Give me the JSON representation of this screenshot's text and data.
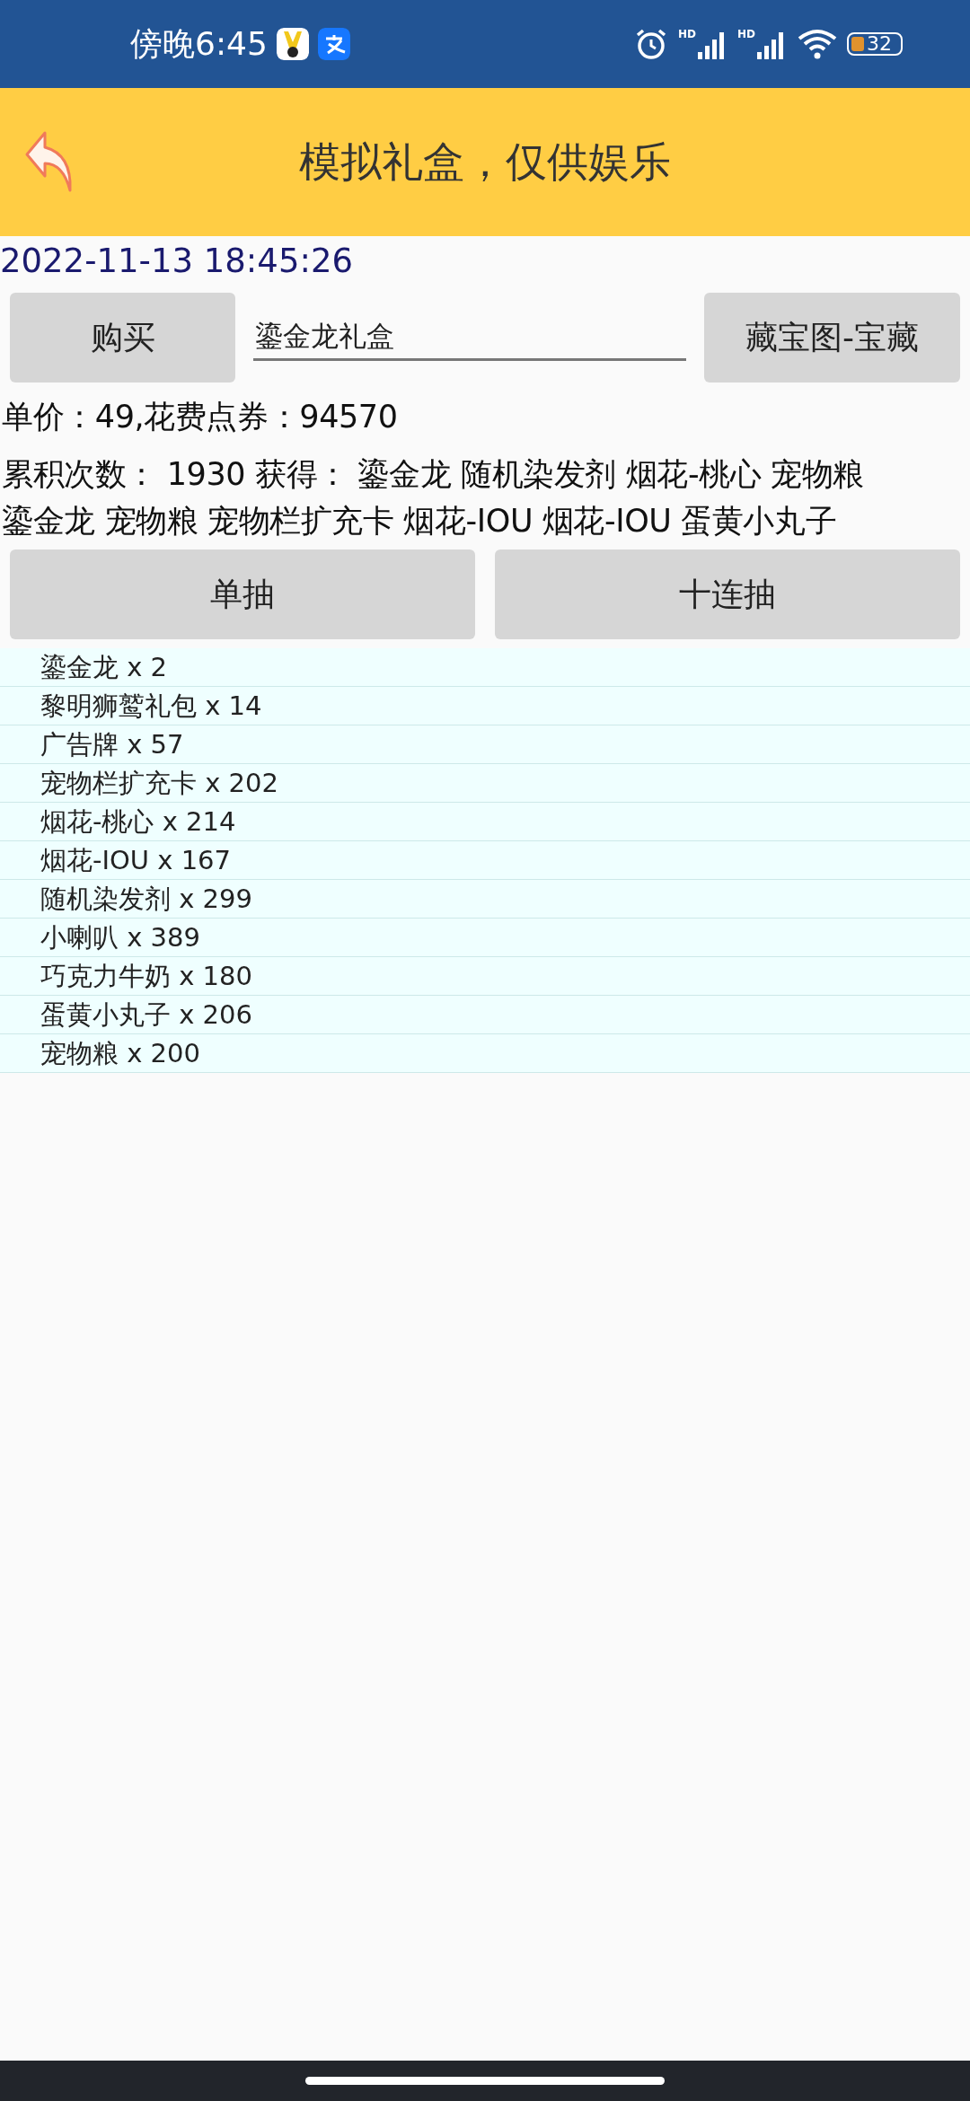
{
  "status_bar": {
    "time": "傍晚6:45",
    "signals": [
      {
        "label": "HD"
      },
      {
        "label": "HD"
      }
    ],
    "battery": "32"
  },
  "header": {
    "title": "模拟礼盒，仅供娱乐"
  },
  "timestamp": "2022-11-13 18:45:26",
  "purchase": {
    "buy_button": "购买",
    "box_field": {
      "value": "鎏金龙礼盒"
    },
    "treasure_button": "藏宝图-宝藏"
  },
  "info_lines": [
    "单价：49,花费点券：94570",
    "累积次数： 1930 获得：  鎏金龙 随机染发剂 烟花-桃心 宠物粮鎏金龙 宠物粮 宠物栏扩充卡 烟花-IOU 烟花-IOU 蛋黄小丸子"
  ],
  "draw_buttons": [
    "单抽",
    "十连抽"
  ],
  "results": [
    "鎏金龙 x 2",
    "黎明狮鹫礼包 x 14",
    "广告牌 x 57",
    "宠物栏扩充卡 x 202",
    "烟花-桃心 x 214",
    "烟花-IOU x 167",
    "随机染发剂 x 299",
    "小喇叭 x 389",
    "巧克力牛奶 x 180",
    "蛋黄小丸子 x 206",
    "宠物粮 x 200"
  ]
}
